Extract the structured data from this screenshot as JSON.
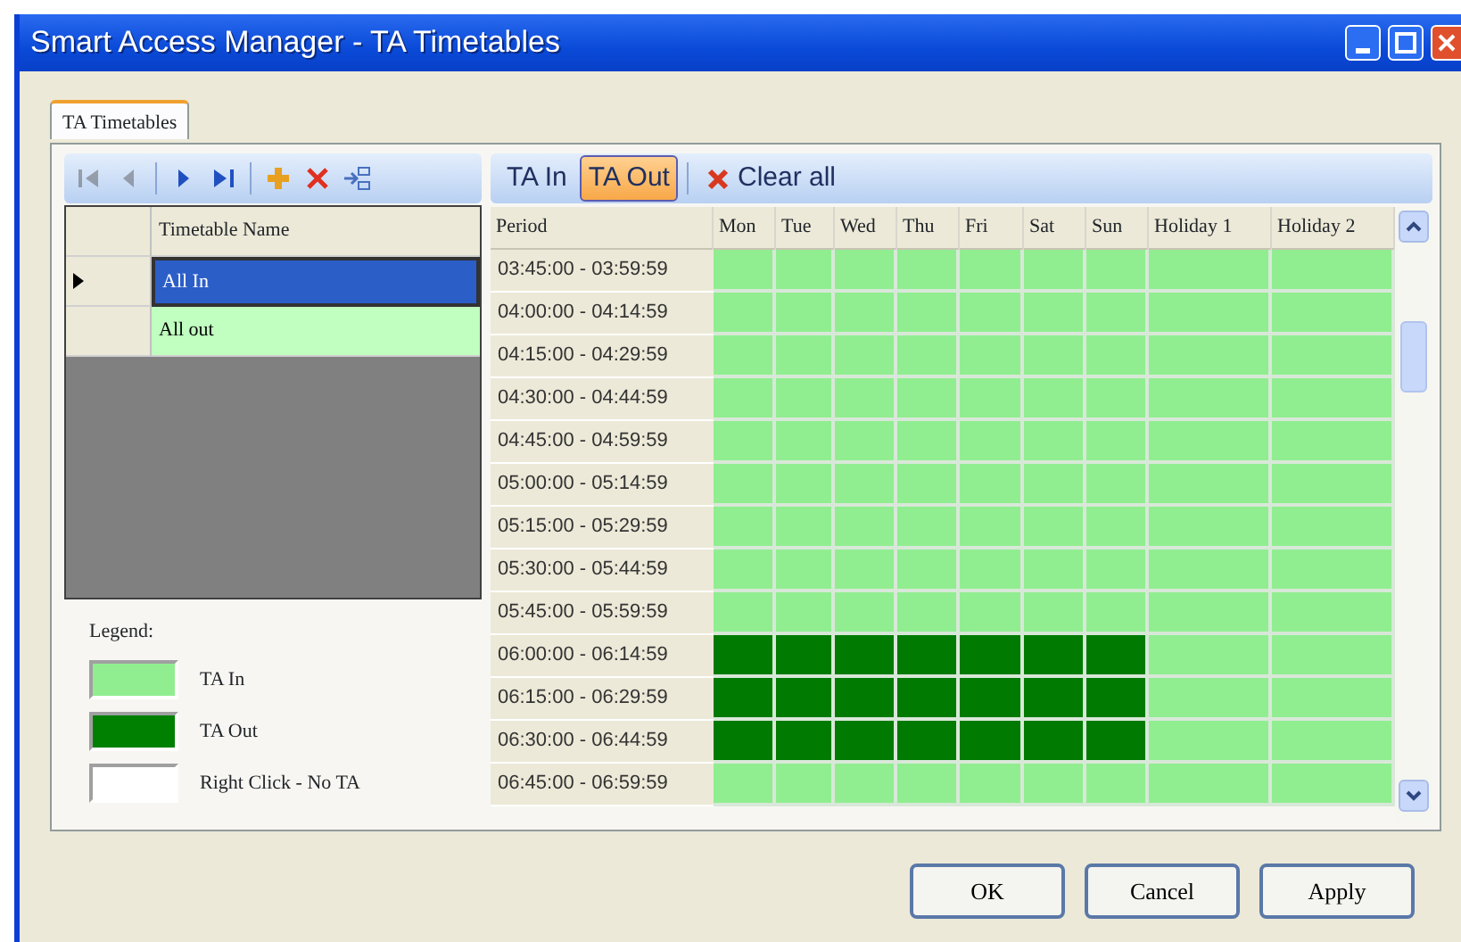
{
  "window": {
    "title": "Smart Access Manager - TA Timetables"
  },
  "tabs": [
    {
      "label": "TA Timetables",
      "selected": true
    }
  ],
  "nav_toolbar": [
    {
      "kind": "first",
      "disabled": true
    },
    {
      "kind": "prev",
      "disabled": true
    },
    {
      "kind": "next",
      "disabled": false
    },
    {
      "kind": "last",
      "disabled": false
    },
    {
      "kind": "add",
      "disabled": false
    },
    {
      "kind": "delete",
      "disabled": false
    },
    {
      "kind": "copy",
      "disabled": false
    }
  ],
  "timetables": {
    "column": "Timetable Name",
    "rows": [
      {
        "name": "All In",
        "selected": true
      },
      {
        "name": "All out",
        "selected": false
      }
    ]
  },
  "legend": {
    "title": "Legend:",
    "items": [
      {
        "label": "TA In",
        "color": "#90ee90"
      },
      {
        "label": "TA Out",
        "color": "#008000"
      },
      {
        "label": "Right Click - No TA",
        "color": "#ffffff"
      }
    ]
  },
  "mode_buttons": [
    {
      "label": "TA In",
      "selected": false
    },
    {
      "label": "TA Out",
      "selected": true
    }
  ],
  "clear_button": {
    "label": "Clear all"
  },
  "schedule": {
    "columns": [
      "Period",
      "Mon",
      "Tue",
      "Wed",
      "Thu",
      "Fri",
      "Sat",
      "Sun",
      "Holiday 1",
      "Holiday 2"
    ],
    "rows": [
      {
        "period": "03:45:00 - 03:59:59",
        "ta_out": [
          false,
          false,
          false,
          false,
          false,
          false,
          false,
          false,
          false
        ]
      },
      {
        "period": "04:00:00 - 04:14:59",
        "ta_out": [
          false,
          false,
          false,
          false,
          false,
          false,
          false,
          false,
          false
        ]
      },
      {
        "period": "04:15:00 - 04:29:59",
        "ta_out": [
          false,
          false,
          false,
          false,
          false,
          false,
          false,
          false,
          false
        ]
      },
      {
        "period": "04:30:00 - 04:44:59",
        "ta_out": [
          false,
          false,
          false,
          false,
          false,
          false,
          false,
          false,
          false
        ]
      },
      {
        "period": "04:45:00 - 04:59:59",
        "ta_out": [
          false,
          false,
          false,
          false,
          false,
          false,
          false,
          false,
          false
        ]
      },
      {
        "period": "05:00:00 - 05:14:59",
        "ta_out": [
          false,
          false,
          false,
          false,
          false,
          false,
          false,
          false,
          false
        ]
      },
      {
        "period": "05:15:00 - 05:29:59",
        "ta_out": [
          false,
          false,
          false,
          false,
          false,
          false,
          false,
          false,
          false
        ]
      },
      {
        "period": "05:30:00 - 05:44:59",
        "ta_out": [
          false,
          false,
          false,
          false,
          false,
          false,
          false,
          false,
          false
        ]
      },
      {
        "period": "05:45:00 - 05:59:59",
        "ta_out": [
          false,
          false,
          false,
          false,
          false,
          false,
          false,
          false,
          false
        ]
      },
      {
        "period": "06:00:00 - 06:14:59",
        "ta_out": [
          true,
          true,
          true,
          true,
          true,
          true,
          true,
          false,
          false
        ]
      },
      {
        "period": "06:15:00 - 06:29:59",
        "ta_out": [
          true,
          true,
          true,
          true,
          true,
          true,
          true,
          false,
          false
        ]
      },
      {
        "period": "06:30:00 - 06:44:59",
        "ta_out": [
          true,
          true,
          true,
          true,
          true,
          true,
          true,
          false,
          false
        ]
      },
      {
        "period": "06:45:00 - 06:59:59",
        "ta_out": [
          false,
          false,
          false,
          false,
          false,
          false,
          false,
          false,
          false
        ]
      }
    ]
  },
  "buttons": [
    "OK",
    "Cancel",
    "Apply"
  ]
}
